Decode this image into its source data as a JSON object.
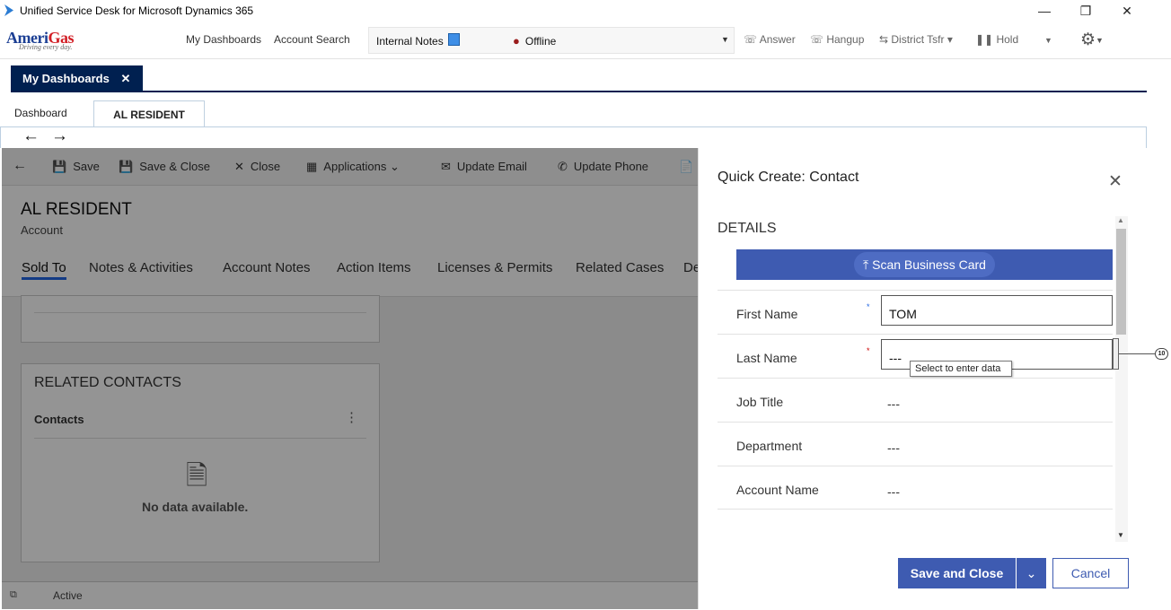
{
  "window": {
    "title": "Unified Service Desk for Microsoft Dynamics 365",
    "minimize": "—",
    "maximize": "❐",
    "close": "✕"
  },
  "brand": {
    "name_a": "Ameri",
    "name_b": "Gas",
    "tagline": "Driving every day."
  },
  "toolbar": {
    "my_dashboards": "My Dashboards",
    "account_search": "Account Search",
    "internal_notes": "Internal Notes",
    "offline": "Offline",
    "answer": "Answer",
    "hangup": "Hangup",
    "district_tsfr": "District Tsfr",
    "hold": "Hold"
  },
  "session_tab": {
    "label": "My Dashboards",
    "close": "✕"
  },
  "sub_tabs": {
    "dashboard": "Dashboard",
    "al_resident": "AL RESIDENT"
  },
  "nav": {
    "back": "←",
    "forward": "→"
  },
  "commands": {
    "save": "Save",
    "save_close": "Save & Close",
    "close": "Close",
    "applications": "Applications",
    "update_email": "Update Email",
    "update_phone": "Update Phone"
  },
  "record": {
    "title": "AL RESIDENT",
    "entity": "Account"
  },
  "record_tabs": [
    "Sold To",
    "Notes & Activities",
    "Account Notes",
    "Action Items",
    "Licenses & Permits",
    "Related Cases",
    "De"
  ],
  "related": {
    "heading": "RELATED CONTACTS",
    "subgrid": "Contacts",
    "empty": "No data available.",
    "more": "⋮"
  },
  "status": {
    "state": "Active"
  },
  "quick_create": {
    "title": "Quick Create: Contact",
    "section": "DETAILS",
    "scan": "Scan Business Card",
    "fields": [
      {
        "label": "First Name",
        "req": "*",
        "value": "TOM"
      },
      {
        "label": "Last Name",
        "req": "*",
        "value": "---"
      },
      {
        "label": "Job Title",
        "value": "---"
      },
      {
        "label": "Department",
        "value": "---"
      },
      {
        "label": "Account Name",
        "value": "---"
      }
    ],
    "tooltip": "Select to enter data",
    "save_close": "Save and Close",
    "cancel": "Cancel"
  },
  "annotation": {
    "badge": "10"
  },
  "colors": {
    "navy": "#002050",
    "primary": "#3e5bb1",
    "brand_blue": "#1c3f94",
    "brand_red": "#d21f26"
  }
}
